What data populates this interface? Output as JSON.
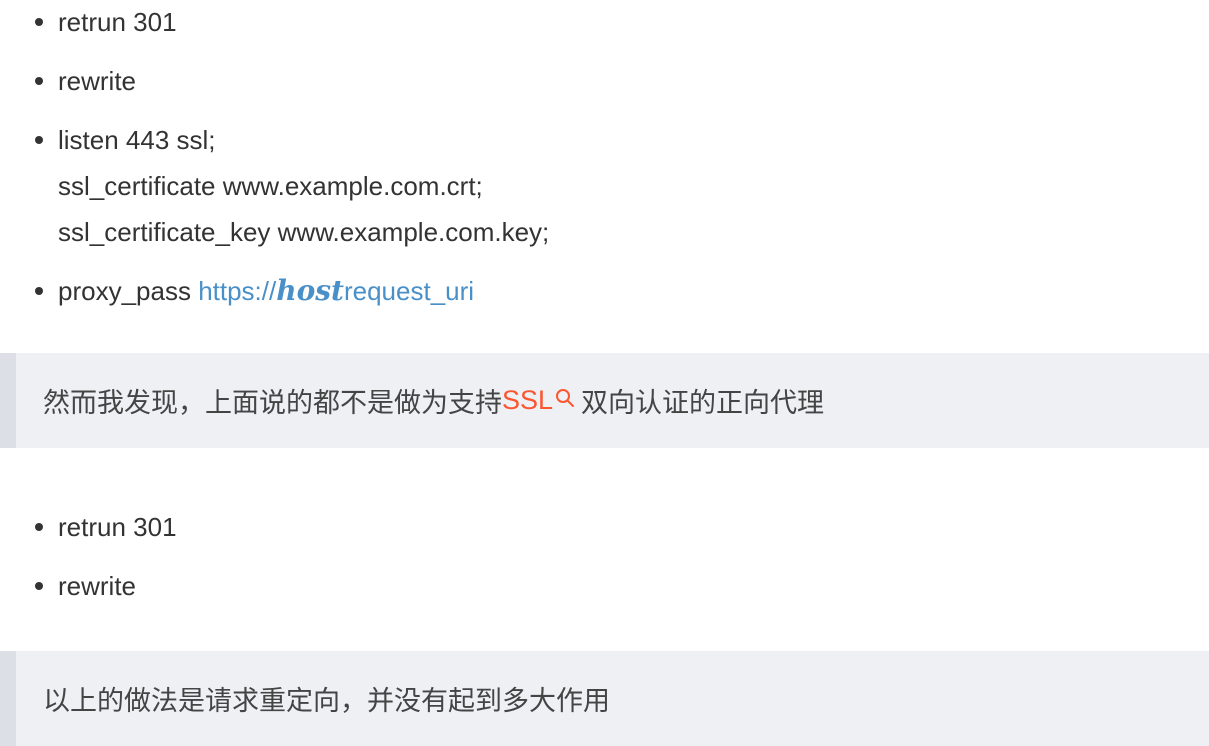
{
  "list1": {
    "items": [
      {
        "text": "retrun 301"
      },
      {
        "text": "rewrite"
      },
      {
        "lines": [
          "listen 443 ssl;",
          "ssl_certificate www.example.com.crt;",
          "ssl_certificate_key www.example.com.key;"
        ]
      },
      {
        "prefix": "proxy_pass ",
        "link_start": "https://",
        "link_math": "host",
        "link_end": "request_uri"
      }
    ]
  },
  "quote1": {
    "before": "然而我发现，上面说的都不是做为支持",
    "keyword": "SSL",
    "after": "双向认证的正向代理"
  },
  "list2": {
    "items": [
      {
        "text": "retrun 301"
      },
      {
        "text": "rewrite"
      }
    ]
  },
  "quote2": {
    "text": "以上的做法是请求重定向，并没有起到多大作用"
  },
  "colors": {
    "text": "#333333",
    "link": "#4a90c8",
    "keyword": "#fc5531",
    "quote_background": "#eef0f4",
    "quote_border": "#dcdfe5"
  }
}
